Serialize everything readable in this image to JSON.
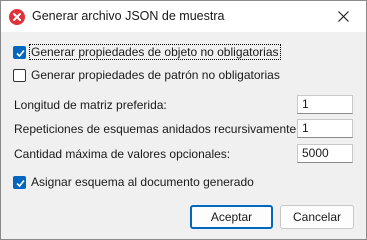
{
  "window": {
    "title": "Generar archivo JSON de muestra",
    "app_icon": "x-circle-icon",
    "close_icon": "close-icon"
  },
  "options": {
    "non_mandatory_object_props": {
      "label": "Generar propiedades de objeto no obligatorias",
      "checked": true
    },
    "non_mandatory_pattern_props": {
      "label": "Generar propiedades de patrón no obligatorias",
      "checked": false
    },
    "assign_schema": {
      "label": "Asignar esquema al documento generado",
      "checked": true
    }
  },
  "fields": {
    "array_length": {
      "label": "Longitud de matriz preferida:",
      "value": "1"
    },
    "recursive_repetitions": {
      "label": "Repeticiones de esquemas anidados recursivamente:",
      "value": "1"
    },
    "max_optional_values": {
      "label": "Cantidad máxima de valores opcionales:",
      "value": "5000"
    }
  },
  "buttons": {
    "ok": "Aceptar",
    "cancel": "Cancelar"
  },
  "colors": {
    "accent": "#0067c0",
    "app_icon": "#e0323a"
  }
}
